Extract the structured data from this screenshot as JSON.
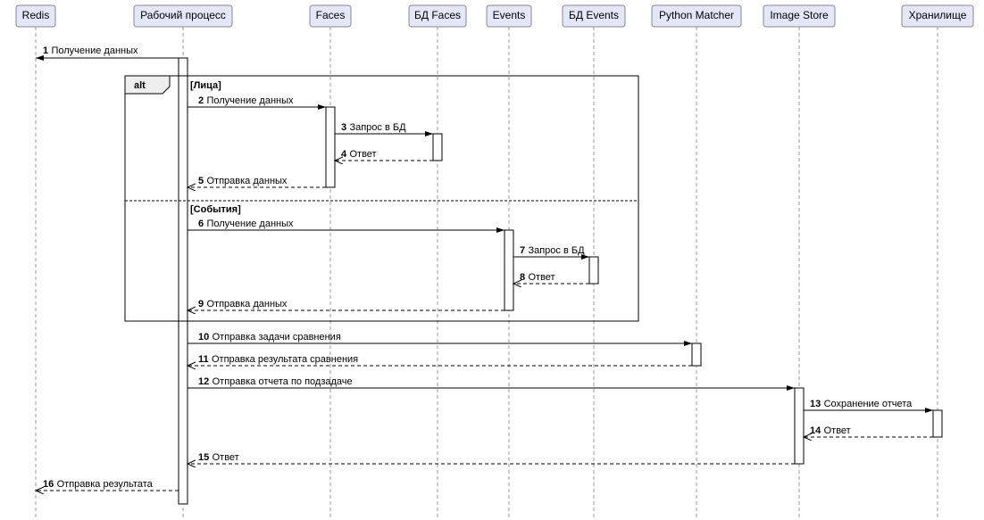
{
  "participants": {
    "redis": "Redis",
    "worker": "Рабочий процесс",
    "faces": "Faces",
    "facesdb": "БД Faces",
    "events": "Events",
    "eventsdb": "БД Events",
    "matcher": "Python Matcher",
    "imagestore": "Image Store",
    "storage": "Хранилище"
  },
  "alt": {
    "label": "alt",
    "guard1": "[Лица]",
    "guard2": "[События]"
  },
  "msgs": {
    "m1": {
      "n": "1",
      "t": "Получение данных"
    },
    "m2": {
      "n": "2",
      "t": "Получение данных"
    },
    "m3": {
      "n": "3",
      "t": "Запрос в БД"
    },
    "m4": {
      "n": "4",
      "t": "Ответ"
    },
    "m5": {
      "n": "5",
      "t": "Отправка данных"
    },
    "m6": {
      "n": "6",
      "t": "Получение данных"
    },
    "m7": {
      "n": "7",
      "t": "Запрос в БД"
    },
    "m8": {
      "n": "8",
      "t": "Ответ"
    },
    "m9": {
      "n": "9",
      "t": "Отправка данных"
    },
    "m10": {
      "n": "10",
      "t": "Отправка задачи сравнения"
    },
    "m11": {
      "n": "11",
      "t": "Отправка результата сравнения"
    },
    "m12": {
      "n": "12",
      "t": "Отправка отчета по подзадаче"
    },
    "m13": {
      "n": "13",
      "t": "Сохранение отчета"
    },
    "m14": {
      "n": "14",
      "t": "Ответ"
    },
    "m15": {
      "n": "15",
      "t": "Ответ"
    },
    "m16": {
      "n": "16",
      "t": "Отправка результата"
    }
  }
}
